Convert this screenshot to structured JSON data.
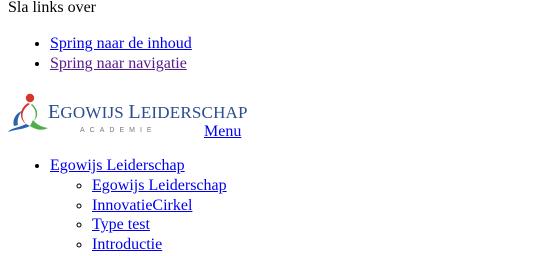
{
  "skip": {
    "title": "Sla links over",
    "links": [
      "Spring naar de inhoud",
      "Spring naar navigatie"
    ]
  },
  "logo": {
    "word_first": "E",
    "word_rest": "GOWIJS ",
    "word_second_first": "L",
    "word_second_rest": "EIDERSCHAP",
    "sub": "ACADEMIE"
  },
  "menu": {
    "label": "Menu"
  },
  "nav": {
    "top_item": "Egowijs Leiderschap",
    "sub_items": [
      "Egowijs Leiderschap",
      "InnovatieCirkel",
      "Type test",
      "Introductie"
    ]
  }
}
